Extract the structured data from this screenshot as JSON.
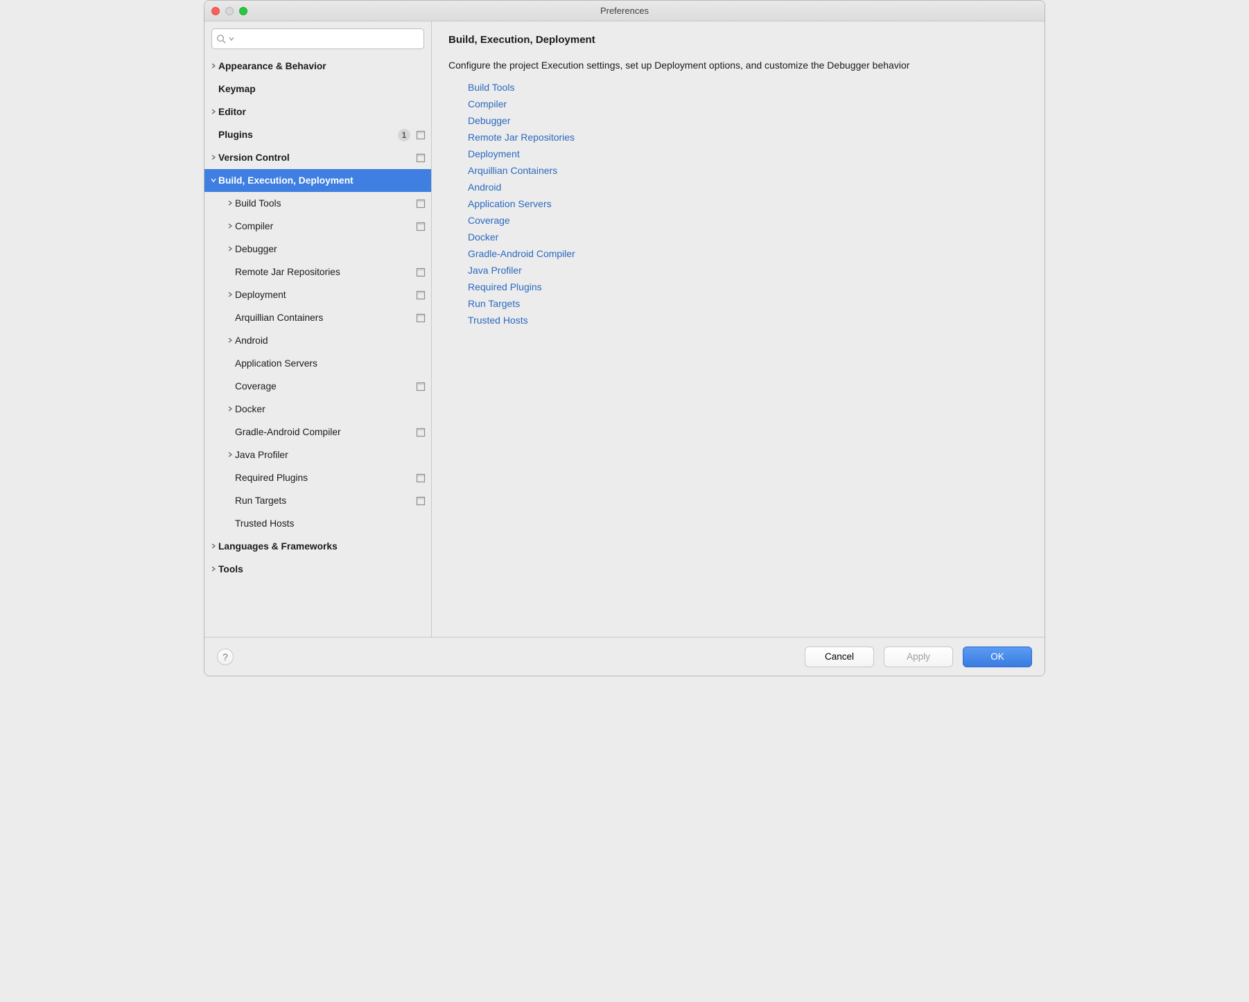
{
  "window": {
    "title": "Preferences"
  },
  "search": {
    "placeholder": ""
  },
  "sidebar": {
    "items": [
      {
        "label": "Appearance & Behavior",
        "level": 0,
        "arrow": "right",
        "bold": true
      },
      {
        "label": "Keymap",
        "level": 0,
        "arrow": "",
        "bold": true
      },
      {
        "label": "Editor",
        "level": 0,
        "arrow": "right",
        "bold": true
      },
      {
        "label": "Plugins",
        "level": 0,
        "arrow": "",
        "bold": true,
        "badge": "1",
        "proj": true
      },
      {
        "label": "Version Control",
        "level": 0,
        "arrow": "right",
        "bold": true,
        "proj": true
      },
      {
        "label": "Build, Execution, Deployment",
        "level": 0,
        "arrow": "down",
        "bold": true,
        "selected": true
      },
      {
        "label": "Build Tools",
        "level": 1,
        "arrow": "right",
        "proj": true
      },
      {
        "label": "Compiler",
        "level": 1,
        "arrow": "right",
        "proj": true
      },
      {
        "label": "Debugger",
        "level": 1,
        "arrow": "right"
      },
      {
        "label": "Remote Jar Repositories",
        "level": 1,
        "arrow": "",
        "proj": true
      },
      {
        "label": "Deployment",
        "level": 1,
        "arrow": "right",
        "proj": true
      },
      {
        "label": "Arquillian Containers",
        "level": 1,
        "arrow": "",
        "proj": true
      },
      {
        "label": "Android",
        "level": 1,
        "arrow": "right"
      },
      {
        "label": "Application Servers",
        "level": 1,
        "arrow": ""
      },
      {
        "label": "Coverage",
        "level": 1,
        "arrow": "",
        "proj": true
      },
      {
        "label": "Docker",
        "level": 1,
        "arrow": "right"
      },
      {
        "label": "Gradle-Android Compiler",
        "level": 1,
        "arrow": "",
        "proj": true
      },
      {
        "label": "Java Profiler",
        "level": 1,
        "arrow": "right"
      },
      {
        "label": "Required Plugins",
        "level": 1,
        "arrow": "",
        "proj": true
      },
      {
        "label": "Run Targets",
        "level": 1,
        "arrow": "",
        "proj": true
      },
      {
        "label": "Trusted Hosts",
        "level": 1,
        "arrow": ""
      },
      {
        "label": "Languages & Frameworks",
        "level": 0,
        "arrow": "right",
        "bold": true
      },
      {
        "label": "Tools",
        "level": 0,
        "arrow": "right",
        "bold": true
      }
    ]
  },
  "main": {
    "heading": "Build, Execution, Deployment",
    "description": "Configure the project Execution settings, set up Deployment options, and customize the Debugger behavior",
    "links": [
      "Build Tools",
      "Compiler",
      "Debugger",
      "Remote Jar Repositories",
      "Deployment",
      "Arquillian Containers",
      "Android",
      "Application Servers",
      "Coverage",
      "Docker",
      "Gradle-Android Compiler",
      "Java Profiler",
      "Required Plugins",
      "Run Targets",
      "Trusted Hosts"
    ]
  },
  "footer": {
    "help": "?",
    "cancel": "Cancel",
    "apply": "Apply",
    "ok": "OK"
  }
}
